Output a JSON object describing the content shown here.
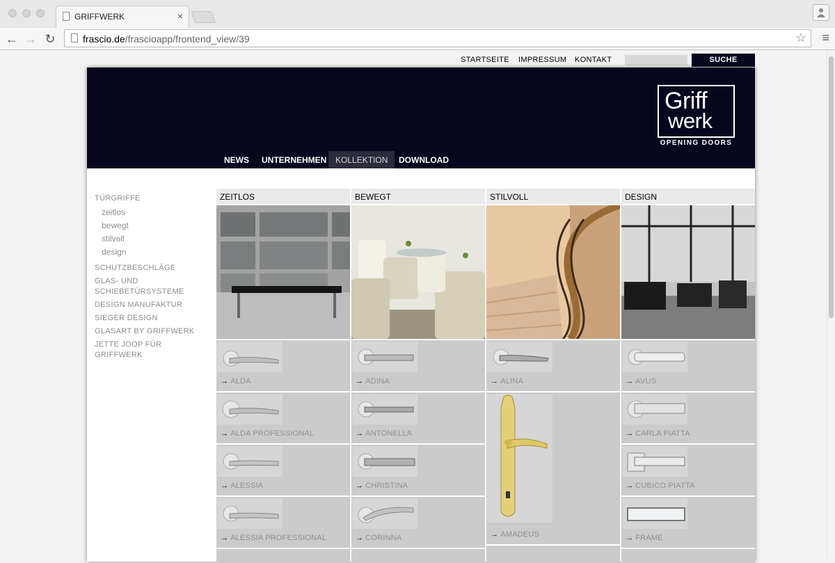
{
  "browser": {
    "tab_title": "GRIFFWERK",
    "url_host": "frascio.de",
    "url_path": "/frascioapp/frontend_view/39"
  },
  "top_links": [
    "STARTSEITE",
    "IMPRESSUM",
    "KONTAKT"
  ],
  "search": {
    "button_label": "SUCHE",
    "value": ""
  },
  "logo": {
    "line1": "Griff",
    "line2": "werk",
    "tagline": "OPENING DOORS"
  },
  "main_nav": [
    "NEWS",
    "UNTERNEHMEN",
    "KOLLEKTION",
    "DOWNLOAD"
  ],
  "sidebar": {
    "heading": "TÜRGRIFFE",
    "sub_items": [
      "zeitlos",
      "bewegt",
      "stilvoll",
      "design"
    ],
    "items": [
      "SCHUTZBESCHLÄGE",
      "GLAS- UND",
      "SCHIEBETÜRSYSTEME",
      "DESIGN MANUFAKTUR",
      "SIEGER DESIGN",
      "GLASART BY GRIFFWERK",
      "JETTE JOOP FÜR",
      "GRIFFWERK"
    ]
  },
  "columns": [
    {
      "title": "ZEITLOS",
      "products": [
        "ALDA",
        "ALDA PROFESSIONAL",
        "ALESSIA",
        "ALESSIA PROFESSIONAL"
      ]
    },
    {
      "title": "BEWEGT",
      "products": [
        "ADINA",
        "ANTONELLA",
        "CHRISTINA",
        "CORINNA"
      ]
    },
    {
      "title": "STILVOLL",
      "products": [
        "ALINA",
        "AMADEUS"
      ]
    },
    {
      "title": "DESIGN",
      "products": [
        "AVUS",
        "CARLA PIATTA",
        "CUBICO PIATTA",
        "FRAME"
      ]
    }
  ],
  "colors": {
    "header_bg": "#06061e",
    "cell_bg": "#cbcbcb",
    "label": "#8f8f8f"
  }
}
